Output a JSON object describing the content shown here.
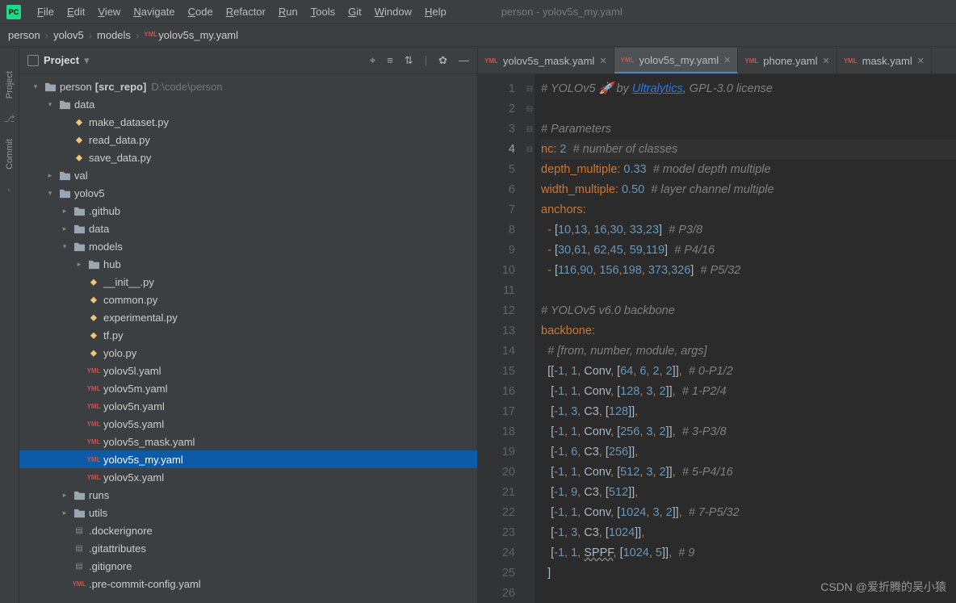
{
  "window_title": "person - yolov5s_my.yaml",
  "menu": [
    "File",
    "Edit",
    "View",
    "Navigate",
    "Code",
    "Refactor",
    "Run",
    "Tools",
    "Git",
    "Window",
    "Help"
  ],
  "breadcrumb": [
    "person",
    "yolov5",
    "models",
    "yolov5s_my.yaml"
  ],
  "sidebar": {
    "title": "Project",
    "rail": {
      "project": "Project",
      "commit": "Commit"
    }
  },
  "tree": [
    {
      "d": 0,
      "exp": "open",
      "icon": "folder",
      "label": "person",
      "aux_b": "[src_repo]",
      "aux": "D:\\code\\person"
    },
    {
      "d": 1,
      "exp": "open",
      "icon": "folder",
      "label": "data"
    },
    {
      "d": 2,
      "icon": "py",
      "label": "make_dataset.py"
    },
    {
      "d": 2,
      "icon": "py",
      "label": "read_data.py"
    },
    {
      "d": 2,
      "icon": "py",
      "label": "save_data.py"
    },
    {
      "d": 1,
      "exp": "closed",
      "icon": "folder",
      "label": "val"
    },
    {
      "d": 1,
      "exp": "open",
      "icon": "folder",
      "label": "yolov5"
    },
    {
      "d": 2,
      "exp": "closed",
      "icon": "folder",
      "label": ".github"
    },
    {
      "d": 2,
      "exp": "closed",
      "icon": "folder",
      "label": "data"
    },
    {
      "d": 2,
      "exp": "open",
      "icon": "folder",
      "label": "models"
    },
    {
      "d": 3,
      "exp": "closed",
      "icon": "folder",
      "label": "hub"
    },
    {
      "d": 3,
      "icon": "py",
      "label": "__init__.py"
    },
    {
      "d": 3,
      "icon": "py",
      "label": "common.py"
    },
    {
      "d": 3,
      "icon": "py",
      "label": "experimental.py"
    },
    {
      "d": 3,
      "icon": "py",
      "label": "tf.py"
    },
    {
      "d": 3,
      "icon": "py",
      "label": "yolo.py"
    },
    {
      "d": 3,
      "icon": "yaml",
      "label": "yolov5l.yaml"
    },
    {
      "d": 3,
      "icon": "yaml",
      "label": "yolov5m.yaml"
    },
    {
      "d": 3,
      "icon": "yaml",
      "label": "yolov5n.yaml"
    },
    {
      "d": 3,
      "icon": "yaml",
      "label": "yolov5s.yaml"
    },
    {
      "d": 3,
      "icon": "yaml",
      "label": "yolov5s_mask.yaml"
    },
    {
      "d": 3,
      "icon": "yaml",
      "label": "yolov5s_my.yaml",
      "selected": true
    },
    {
      "d": 3,
      "icon": "yaml",
      "label": "yolov5x.yaml"
    },
    {
      "d": 2,
      "exp": "closed",
      "icon": "folder",
      "label": "runs"
    },
    {
      "d": 2,
      "exp": "closed",
      "icon": "folder",
      "label": "utils"
    },
    {
      "d": 2,
      "icon": "file",
      "label": ".dockerignore"
    },
    {
      "d": 2,
      "icon": "file",
      "label": ".gitattributes"
    },
    {
      "d": 2,
      "icon": "file",
      "label": ".gitignore"
    },
    {
      "d": 2,
      "icon": "yaml",
      "label": ".pre-commit-config.yaml"
    }
  ],
  "tabs": [
    {
      "label": "yolov5s_mask.yaml",
      "icon": "yaml"
    },
    {
      "label": "yolov5s_my.yaml",
      "icon": "yaml",
      "active": true
    },
    {
      "label": "phone.yaml",
      "icon": "yaml"
    },
    {
      "label": "mask.yaml",
      "icon": "yaml"
    }
  ],
  "code": {
    "current_line": 4,
    "lines": [
      {
        "html": "<span class='c-comment'># YOLOv5 🚀 by <span class='c-link'>Ultralytics</span>, GPL-3.0 license</span>"
      },
      {
        "html": ""
      },
      {
        "html": "<span class='c-comment'># Parameters</span>"
      },
      {
        "html": "<span class='c-key'>nc</span><span class='c-punct'>:</span> <span class='c-val'>2</span>  <span class='c-comment'># number of classes</span>"
      },
      {
        "html": "<span class='c-key'>depth_multiple</span><span class='c-punct'>:</span> <span class='c-val'>0.33</span>  <span class='c-comment'># model depth multiple</span>"
      },
      {
        "html": "<span class='c-key'>width_multiple</span><span class='c-punct'>:</span> <span class='c-val'>0.50</span>  <span class='c-comment'># layer channel multiple</span>"
      },
      {
        "fold": "⊟",
        "html": "<span class='c-key'>anchors</span><span class='c-punct'>:</span>"
      },
      {
        "html": "  <span class='c-punct'>-</span> <span class='c-txt'>[</span><span class='c-val'>10</span><span class='c-punct'>,</span><span class='c-val'>13</span><span class='c-punct'>,</span> <span class='c-val'>16</span><span class='c-punct'>,</span><span class='c-val'>30</span><span class='c-punct'>,</span> <span class='c-val'>33</span><span class='c-punct'>,</span><span class='c-val'>23</span><span class='c-txt'>]</span>  <span class='c-comment'># P3/8</span>"
      },
      {
        "html": "  <span class='c-punct'>-</span> <span class='c-txt'>[</span><span class='c-val'>30</span><span class='c-punct'>,</span><span class='c-val'>61</span><span class='c-punct'>,</span> <span class='c-val'>62</span><span class='c-punct'>,</span><span class='c-val'>45</span><span class='c-punct'>,</span> <span class='c-val'>59</span><span class='c-punct'>,</span><span class='c-val'>119</span><span class='c-txt'>]</span>  <span class='c-comment'># P4/16</span>"
      },
      {
        "fold": "⊟",
        "html": "  <span class='c-punct'>-</span> <span class='c-txt'>[</span><span class='c-val'>116</span><span class='c-punct'>,</span><span class='c-val'>90</span><span class='c-punct'>,</span> <span class='c-val'>156</span><span class='c-punct'>,</span><span class='c-val'>198</span><span class='c-punct'>,</span> <span class='c-val'>373</span><span class='c-punct'>,</span><span class='c-val'>326</span><span class='c-txt'>]</span>  <span class='c-comment'># P5/32</span>"
      },
      {
        "html": ""
      },
      {
        "html": "<span class='c-comment'># YOLOv5 v6.0 backbone</span>"
      },
      {
        "fold": "⊟",
        "html": "<span class='c-key'>backbone</span><span class='c-punct'>:</span>"
      },
      {
        "html": "  <span class='c-comment'># [from, number, module, args]</span>"
      },
      {
        "html": "  <span class='c-txt'>[[</span><span class='c-val'>-1</span><span class='c-punct'>,</span> <span class='c-val'>1</span><span class='c-punct'>,</span> <span class='c-txt'>Conv</span><span class='c-punct'>,</span> <span class='c-txt'>[</span><span class='c-val'>64</span><span class='c-punct'>,</span> <span class='c-val'>6</span><span class='c-punct'>,</span> <span class='c-val'>2</span><span class='c-punct'>,</span> <span class='c-val'>2</span><span class='c-txt'>]]</span><span class='c-punct'>,</span>  <span class='c-comment'># 0-P1/2</span>"
      },
      {
        "html": "   <span class='c-txt'>[</span><span class='c-val'>-1</span><span class='c-punct'>,</span> <span class='c-val'>1</span><span class='c-punct'>,</span> <span class='c-txt'>Conv</span><span class='c-punct'>,</span> <span class='c-txt'>[</span><span class='c-val'>128</span><span class='c-punct'>,</span> <span class='c-val'>3</span><span class='c-punct'>,</span> <span class='c-val'>2</span><span class='c-txt'>]]</span><span class='c-punct'>,</span>  <span class='c-comment'># 1-P2/4</span>"
      },
      {
        "html": "   <span class='c-txt'>[</span><span class='c-val'>-1</span><span class='c-punct'>,</span> <span class='c-val'>3</span><span class='c-punct'>,</span> <span class='c-txt'>C3</span><span class='c-punct'>,</span> <span class='c-txt'>[</span><span class='c-val'>128</span><span class='c-txt'>]]</span><span class='c-punct'>,</span>"
      },
      {
        "html": "   <span class='c-txt'>[</span><span class='c-val'>-1</span><span class='c-punct'>,</span> <span class='c-val'>1</span><span class='c-punct'>,</span> <span class='c-txt'>Conv</span><span class='c-punct'>,</span> <span class='c-txt'>[</span><span class='c-val'>256</span><span class='c-punct'>,</span> <span class='c-val'>3</span><span class='c-punct'>,</span> <span class='c-val'>2</span><span class='c-txt'>]]</span><span class='c-punct'>,</span>  <span class='c-comment'># 3-P3/8</span>"
      },
      {
        "html": "   <span class='c-txt'>[</span><span class='c-val'>-1</span><span class='c-punct'>,</span> <span class='c-val'>6</span><span class='c-punct'>,</span> <span class='c-txt'>C3</span><span class='c-punct'>,</span> <span class='c-txt'>[</span><span class='c-val'>256</span><span class='c-txt'>]]</span><span class='c-punct'>,</span>"
      },
      {
        "html": "   <span class='c-txt'>[</span><span class='c-val'>-1</span><span class='c-punct'>,</span> <span class='c-val'>1</span><span class='c-punct'>,</span> <span class='c-txt'>Conv</span><span class='c-punct'>,</span> <span class='c-txt'>[</span><span class='c-val'>512</span><span class='c-punct'>,</span> <span class='c-val'>3</span><span class='c-punct'>,</span> <span class='c-val'>2</span><span class='c-txt'>]]</span><span class='c-punct'>,</span>  <span class='c-comment'># 5-P4/16</span>"
      },
      {
        "html": "   <span class='c-txt'>[</span><span class='c-val'>-1</span><span class='c-punct'>,</span> <span class='c-val'>9</span><span class='c-punct'>,</span> <span class='c-txt'>C3</span><span class='c-punct'>,</span> <span class='c-txt'>[</span><span class='c-val'>512</span><span class='c-txt'>]]</span><span class='c-punct'>,</span>"
      },
      {
        "html": "   <span class='c-txt'>[</span><span class='c-val'>-1</span><span class='c-punct'>,</span> <span class='c-val'>1</span><span class='c-punct'>,</span> <span class='c-txt'>Conv</span><span class='c-punct'>,</span> <span class='c-txt'>[</span><span class='c-val'>1024</span><span class='c-punct'>,</span> <span class='c-val'>3</span><span class='c-punct'>,</span> <span class='c-val'>2</span><span class='c-txt'>]]</span><span class='c-punct'>,</span>  <span class='c-comment'># 7-P5/32</span>"
      },
      {
        "html": "   <span class='c-txt'>[</span><span class='c-val'>-1</span><span class='c-punct'>,</span> <span class='c-val'>3</span><span class='c-punct'>,</span> <span class='c-txt'>C3</span><span class='c-punct'>,</span> <span class='c-txt'>[</span><span class='c-val'>1024</span><span class='c-txt'>]]</span><span class='c-punct'>,</span>"
      },
      {
        "html": "   <span class='c-txt'>[</span><span class='c-val'>-1</span><span class='c-punct'>,</span> <span class='c-val'>1</span><span class='c-punct'>,</span> <span class='c-txt c-wavy'>SPPF</span><span class='c-punct'>,</span> <span class='c-txt'>[</span><span class='c-val'>1024</span><span class='c-punct'>,</span> <span class='c-val'>5</span><span class='c-txt'>]]</span><span class='c-punct'>,</span>  <span class='c-comment'># 9</span>"
      },
      {
        "fold": "⊟",
        "html": "  <span class='c-txt'>]</span>"
      },
      {
        "html": ""
      }
    ]
  },
  "watermark": "CSDN @爱折腾的吴小猿"
}
